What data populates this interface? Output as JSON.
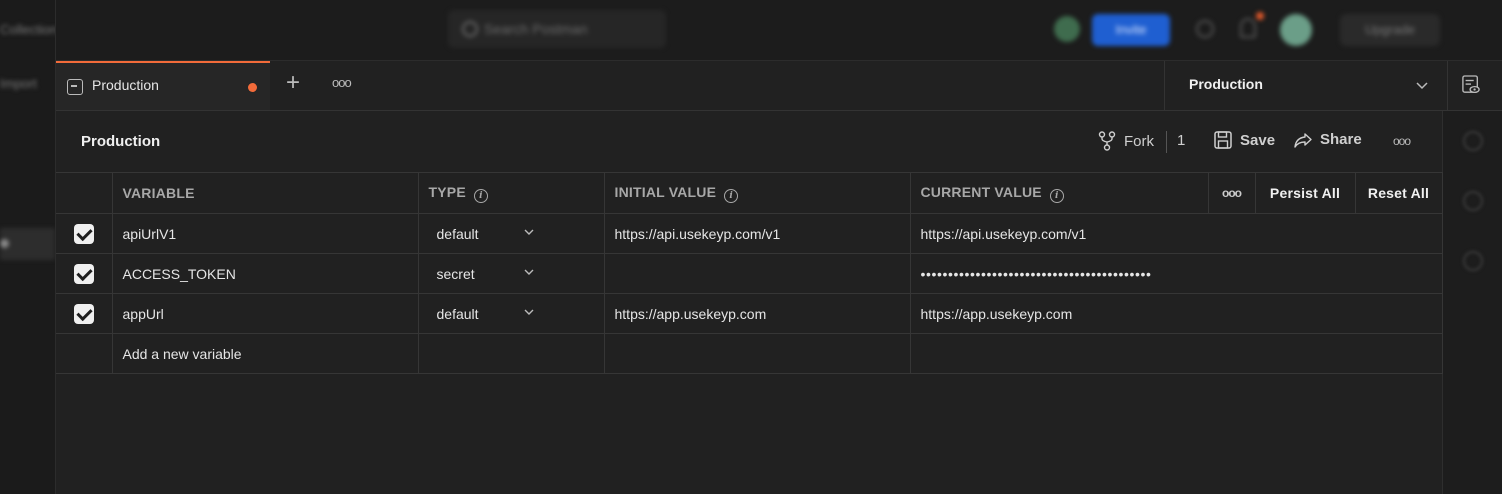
{
  "header": {
    "search_placeholder": "Search Postman",
    "invite_label": "Invite",
    "upgrade_label": "Upgrade"
  },
  "sidebar": {
    "items": [
      {
        "label": "Collections"
      },
      {
        "label": "Import"
      }
    ]
  },
  "tabs": [
    {
      "label": "Production",
      "unsaved": true,
      "active": true
    }
  ],
  "environment_selector": {
    "selected": "Production"
  },
  "panel": {
    "title": "Production",
    "fork_label": "Fork",
    "fork_count": "1",
    "save_label": "Save",
    "share_label": "Share"
  },
  "table": {
    "columns": {
      "variable": "VARIABLE",
      "type": "TYPE",
      "initial_value": "INITIAL VALUE",
      "current_value": "CURRENT VALUE"
    },
    "persist_all_label": "Persist All",
    "reset_all_label": "Reset All",
    "rows": [
      {
        "enabled": true,
        "variable": "apiUrlV1",
        "type": "default",
        "initial_value": "https://api.usekeyp.com/v1",
        "current_value": "https://api.usekeyp.com/v1"
      },
      {
        "enabled": true,
        "variable": "ACCESS_TOKEN",
        "type": "secret",
        "initial_value": "",
        "current_value": "••••••••••••••••••••••••••••••••••••••••••"
      },
      {
        "enabled": true,
        "variable": "appUrl",
        "type": "default",
        "initial_value": "https://app.usekeyp.com",
        "current_value": "https://app.usekeyp.com"
      }
    ],
    "add_placeholder": "Add a new variable"
  },
  "colors": {
    "background": "#212121",
    "accent_orange": "#f26b3a",
    "header_blue": "#1f5fd1"
  }
}
